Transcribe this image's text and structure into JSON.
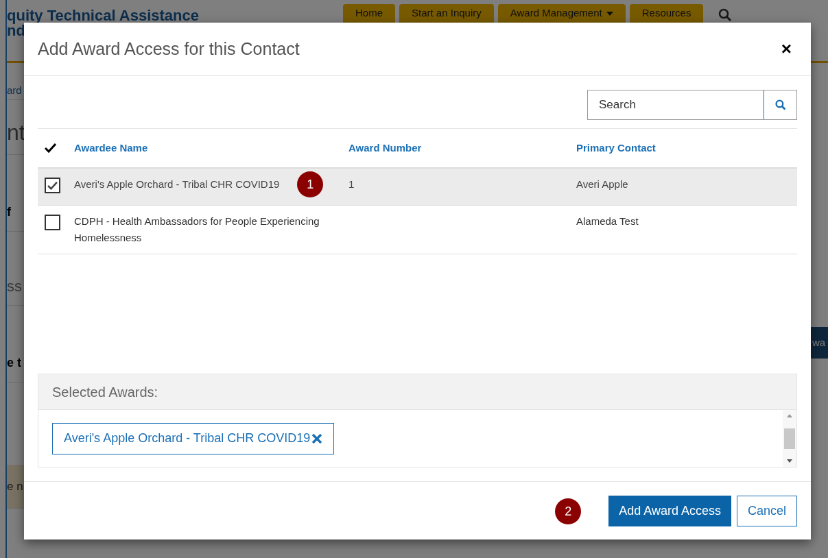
{
  "background": {
    "title_lines": [
      "quity Technical Assistance",
      "nd"
    ],
    "nav": [
      {
        "label": "Home",
        "dropdown": false
      },
      {
        "label": "Start an Inquiry",
        "dropdown": false
      },
      {
        "label": "Award Management",
        "dropdown": true
      },
      {
        "label": "Resources",
        "dropdown": false
      }
    ],
    "left_fragments": [
      {
        "text": "ard",
        "kind": "link"
      },
      {
        "text": "nt",
        "kind": "heading"
      },
      {
        "text": "f",
        "kind": "bold"
      },
      {
        "text": "ss",
        "kind": "plain"
      },
      {
        "text": "e t",
        "kind": "bold"
      },
      {
        "text": "e n",
        "kind": "banner"
      }
    ],
    "right_button": "wa"
  },
  "dialog": {
    "title": "Add Award Access for this Contact",
    "close": "×",
    "search": {
      "placeholder": "Search"
    },
    "columns": [
      "Awardee Name",
      "Award Number",
      "Primary Contact"
    ],
    "rows": [
      {
        "awardee": "Averi's Apple Orchard - Tribal CHR COVID19",
        "award_number": "1",
        "primary_contact": "Averi Apple",
        "checked": true,
        "callout": "1"
      },
      {
        "awardee": "CDPH - Health Ambassadors for People Experiencing Homelessness",
        "primary_contact": "Alameda Test",
        "checked": false
      }
    ],
    "selected_awards": {
      "title": "Selected Awards:",
      "tags": [
        "Averi's Apple Orchard - Tribal CHR COVID19"
      ]
    },
    "footer_callout": "2",
    "buttons": [
      {
        "label": "Add Award Access",
        "kind": "primary"
      },
      {
        "label": "Cancel",
        "kind": "secondary"
      }
    ]
  }
}
